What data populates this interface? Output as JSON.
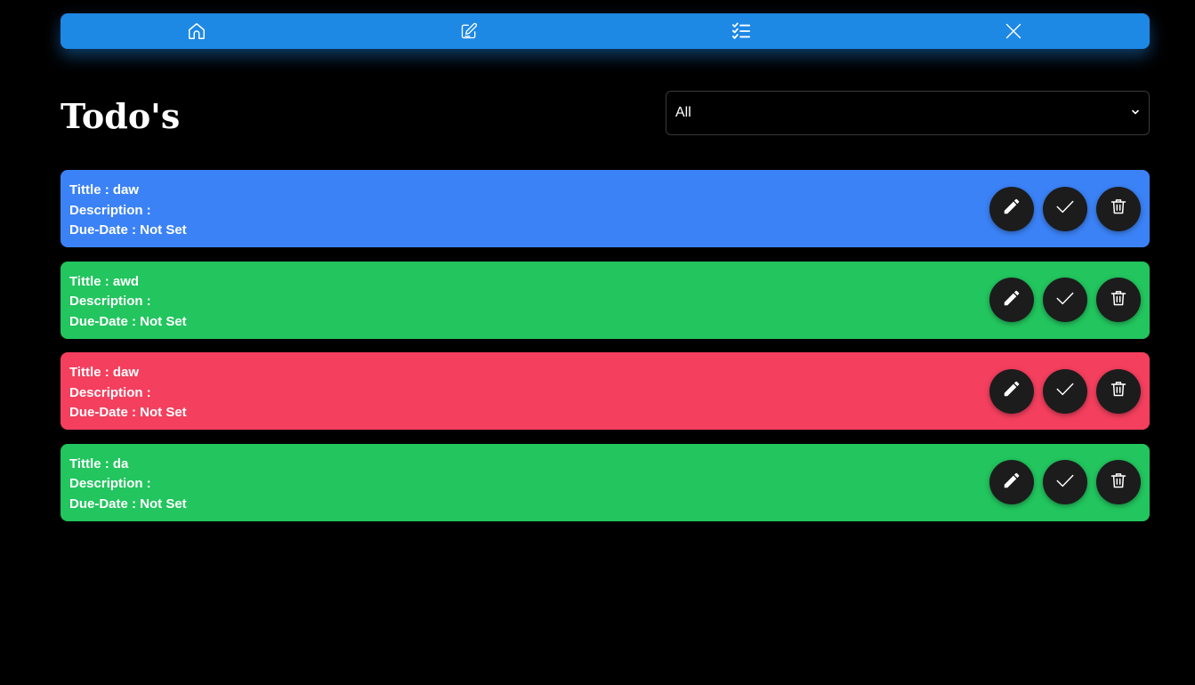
{
  "nav": {
    "background": "#1e88e5",
    "items": [
      {
        "icon": "home-icon"
      },
      {
        "icon": "edit-note-icon"
      },
      {
        "icon": "checklist-icon"
      },
      {
        "icon": "close-icon"
      }
    ]
  },
  "header": {
    "title": "Todo's"
  },
  "filter": {
    "selected": "All"
  },
  "todos": [
    {
      "title": "Tittle : daw",
      "description": "Description :",
      "due": "Due-Date : Not Set",
      "color": "#3b82f6"
    },
    {
      "title": "Tittle : awd",
      "description": "Description :",
      "due": "Due-Date : Not Set",
      "color": "#22c55e"
    },
    {
      "title": "Tittle : daw",
      "description": "Description :",
      "due": "Due-Date : Not Set",
      "color": "#f43f5e"
    },
    {
      "title": "Tittle : da",
      "description": "Description :",
      "due": "Due-Date : Not Set",
      "color": "#22c55e"
    }
  ],
  "actions": [
    {
      "icon": "pencil-icon"
    },
    {
      "icon": "check-icon"
    },
    {
      "icon": "trash-icon"
    }
  ]
}
